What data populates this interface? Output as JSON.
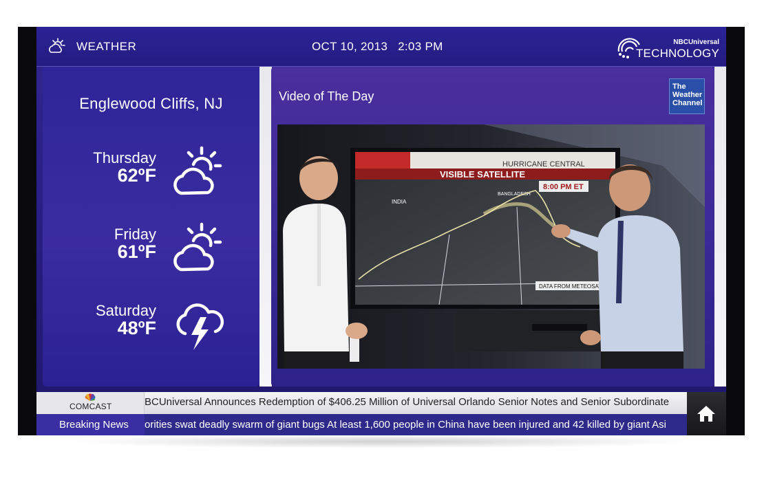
{
  "header": {
    "weather_label": "WEATHER",
    "date": "OCT 10, 2013",
    "time": "2:03 PM",
    "brand_top": "NBCUniversal",
    "brand_main": "TECHNOLOGY"
  },
  "weather": {
    "city": "Englewood Cliffs, NJ",
    "forecast": [
      {
        "day": "Thursday",
        "temp": "62ºF",
        "icon": "partly-sunny-icon"
      },
      {
        "day": "Friday",
        "temp": "61ºF",
        "icon": "partly-sunny-icon"
      },
      {
        "day": "Saturday",
        "temp": "48ºF",
        "icon": "thunderstorm-icon"
      }
    ]
  },
  "video": {
    "title": "Video of The Day",
    "channel_logo": "The Weather Channel",
    "screen_text": {
      "banner": "HURRICANE CENTRAL",
      "headline": "VISIBLE SATELLITE",
      "time": "8:00 PM ET",
      "region_india": "INDIA",
      "region_bangladesh": "BANGLADESH",
      "source": "DATA FROM METEOSAT"
    }
  },
  "tickers": {
    "sponsor": "COMCAST",
    "news_ticker": "BCUniversal Announces Redemption of $406.25 Million of Universal Orlando Senior Notes and Senior Subordinate",
    "breaking_label": "Breaking News",
    "breaking_ticker": "orities swat deadly swarm of giant bugs At least 1,600 people in China have been injured and 42 killed by giant Asi"
  },
  "colors": {
    "panel_purple": "#2e2598",
    "ticker_light": "#e7e7ea",
    "breaking_bar": "#2e2a8c",
    "twc_blue": "#2a4fa8"
  }
}
